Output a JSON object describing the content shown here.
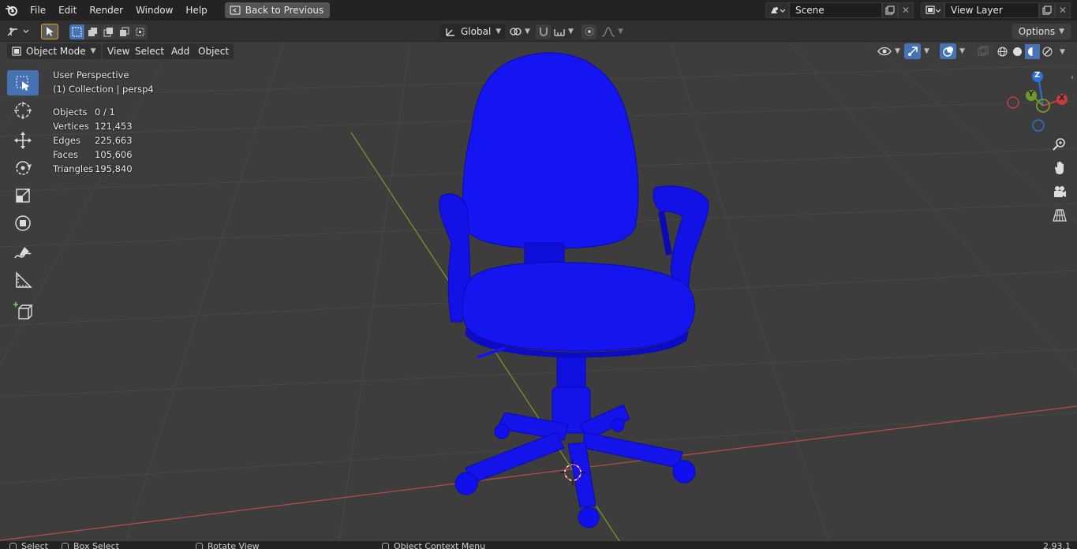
{
  "app": {
    "name": "Blender"
  },
  "menu": [
    "File",
    "Edit",
    "Render",
    "Window",
    "Help"
  ],
  "back_button": "Back to Previous",
  "scene": {
    "label": "Scene"
  },
  "view_layer": {
    "label": "View Layer"
  },
  "tool_header": {
    "transform_orientation": "Global",
    "options_label": "Options"
  },
  "viewport_header": {
    "mode": "Object Mode",
    "menus": [
      "View",
      "Select",
      "Add",
      "Object"
    ]
  },
  "hud": {
    "perspective": "User Perspective",
    "collection": "(1) Collection | persp4",
    "stats": [
      {
        "label": "Objects",
        "value": "0 / 1"
      },
      {
        "label": "Vertices",
        "value": "121,453"
      },
      {
        "label": "Edges",
        "value": "225,663"
      },
      {
        "label": "Faces",
        "value": "105,606"
      },
      {
        "label": "Triangles",
        "value": "195,840"
      }
    ]
  },
  "gizmo": {
    "z": "Z",
    "y": "Y",
    "x": "X"
  },
  "toolbar_icons": [
    "select-box-icon",
    "cursor-icon",
    "move-icon",
    "rotate-icon",
    "scale-icon",
    "transform-icon",
    "annotate-icon",
    "measure-icon",
    "add-cube-icon"
  ],
  "statusbar": {
    "select": "Select",
    "box_select": "Box Select",
    "rotate_view": "Rotate View",
    "context_menu": "Object Context Menu",
    "version": "2.93.1"
  },
  "colors": {
    "model": "#1010ee",
    "viewport_bg": "#3d3d3d",
    "accent": "#4772b3",
    "x_axis": "#c43c3c",
    "y_axis": "#6f9a2a",
    "z_axis": "#2f6fd6"
  }
}
